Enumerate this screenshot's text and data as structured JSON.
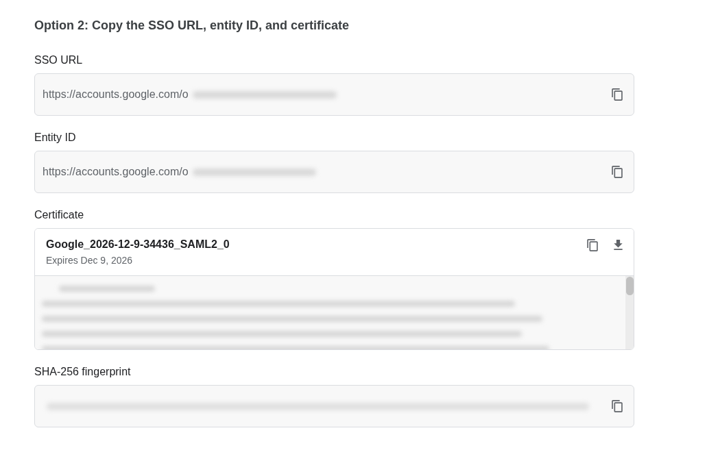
{
  "heading": "Option 2: Copy the SSO URL, entity ID, and certificate",
  "fields": [
    {
      "kind": "url",
      "label": "SSO URL",
      "value": "https://accounts.google.com/o",
      "redacted": true
    },
    {
      "kind": "url",
      "label": "Entity ID",
      "value": "https://accounts.google.com/o",
      "redacted": true
    },
    {
      "kind": "certificate",
      "label": "Certificate",
      "name": "Google_2026-12-9-34436_SAML2_0",
      "expiry": "Expires Dec 9, 2026",
      "redacted": true
    },
    {
      "kind": "fingerprint",
      "label": "SHA-256 fingerprint",
      "redacted": true
    }
  ]
}
